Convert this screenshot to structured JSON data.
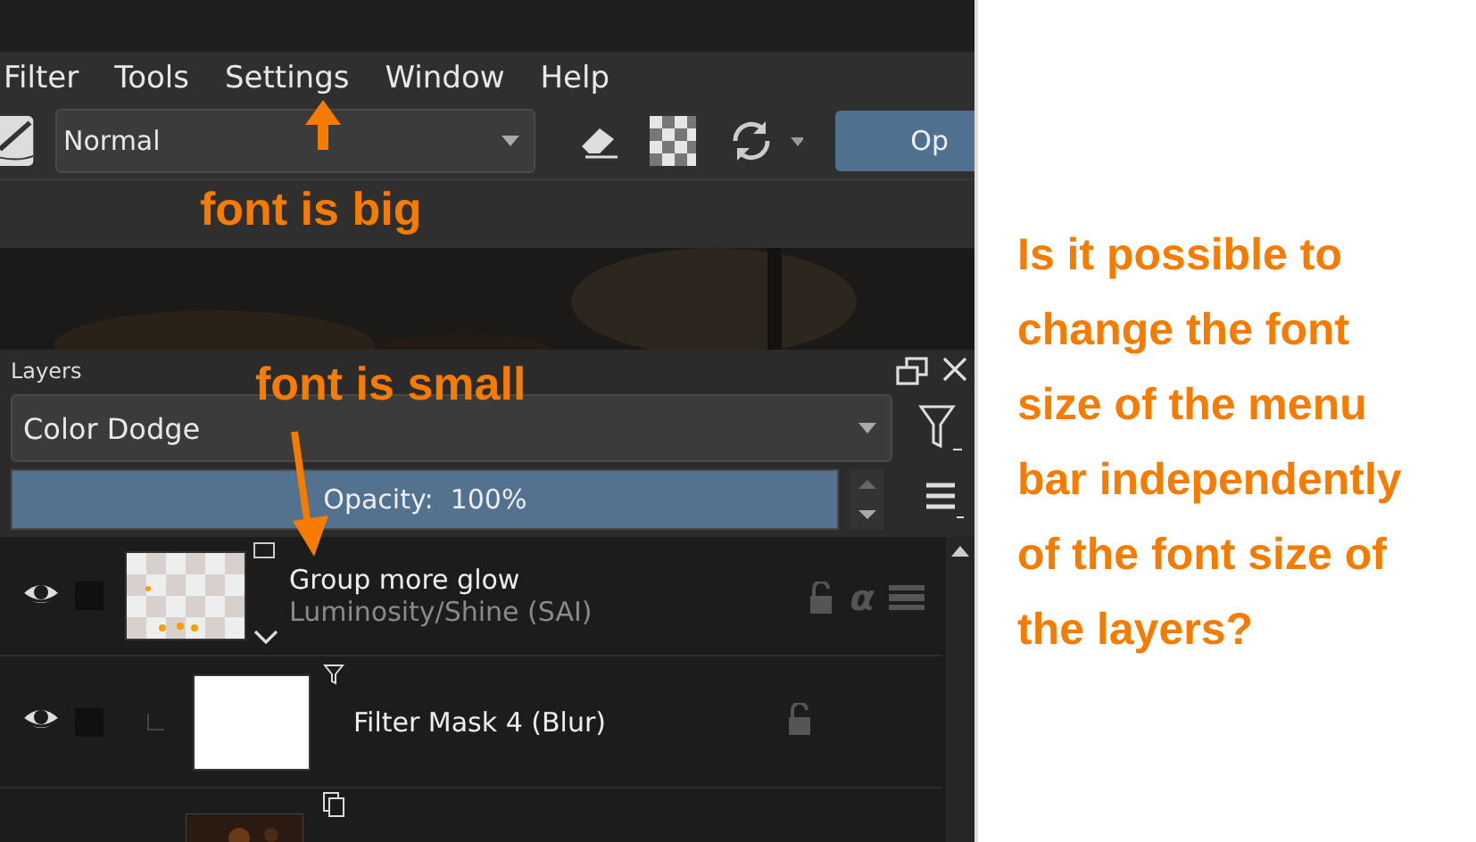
{
  "menu": [
    {
      "label": "Filter"
    },
    {
      "label": "Tools"
    },
    {
      "label": "Settings"
    },
    {
      "label": "Window"
    },
    {
      "label": "Help"
    }
  ],
  "toolbar": {
    "blend_mode": "Normal",
    "opacity_button": "Op"
  },
  "layers_panel": {
    "title": "Layers",
    "blend_mode": "Color Dodge",
    "opacity": {
      "label": "Opacity:  100%",
      "level": 1.0
    }
  },
  "layers": [
    {
      "kind": "group",
      "name": "Group more glow",
      "subtitle": "Luminosity/Shine (SAI)",
      "visible": true,
      "alpha_lock": "α"
    },
    {
      "kind": "filter_mask",
      "name": "Filter Mask 4 (Blur)",
      "visible": true
    },
    {
      "kind": "clone"
    }
  ],
  "annotations": [
    {
      "kind": "arrow_up",
      "text": "font is big"
    },
    {
      "kind": "arrow_down",
      "text": "font is small"
    }
  ],
  "question": "Is it possible to change the font size of the menu bar independently of the font size of the layers?"
}
